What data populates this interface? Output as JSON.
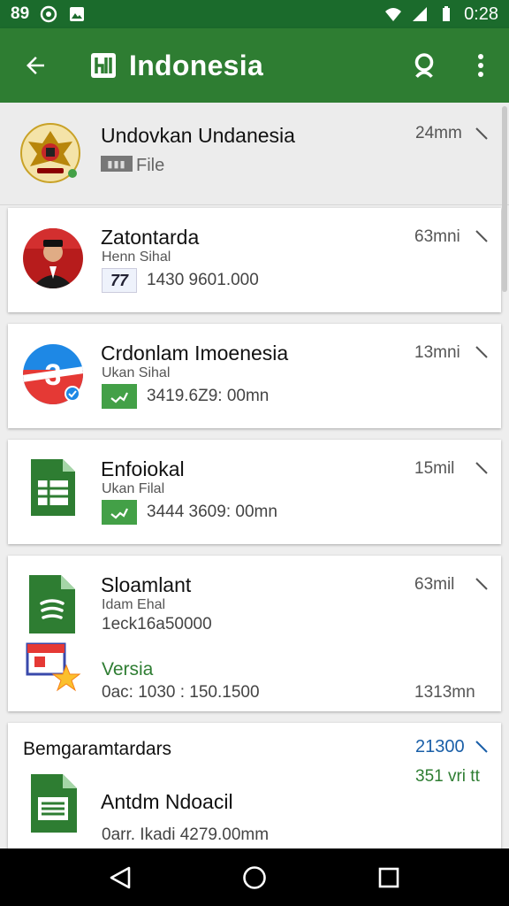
{
  "status_bar": {
    "left_text": "89",
    "time": "0:28"
  },
  "app_bar": {
    "title": "Indonesia"
  },
  "items": [
    {
      "name": "Undovkan Undanesia",
      "sub": "File",
      "time": "24mm"
    },
    {
      "name": "Zatontarda",
      "sub": "Henn Sihal",
      "meta": "1430 9601.000",
      "time": "63mni",
      "badge": "77"
    },
    {
      "name": "Crdonlam Imoenesia",
      "sub": "Ukan Sihal",
      "meta": "3419.6Z9: 00mn",
      "time": "13mni",
      "avatar_badge": "3"
    },
    {
      "name": "Enfoiokal",
      "sub": "Ukan Filal",
      "meta": "3444 3609: 00mn",
      "time": "15mil"
    },
    {
      "name": "Sloamlant",
      "sub": "Idam Ehal",
      "meta": "1eck16a50000",
      "time": "63mil",
      "version_label": "Versia",
      "version_meta": "0ac: 1030 : 150.1500",
      "version_time": "1313mn"
    },
    {
      "header": "Bemgaramtardars",
      "header_time": "21300",
      "header_sub": "351 vri tt",
      "name": "Antdm Ndoacil",
      "meta": "0arr. Ikadi 4279.00mm"
    }
  ],
  "colors": {
    "primary": "#2e7d32",
    "status": "#1b6b2c"
  }
}
